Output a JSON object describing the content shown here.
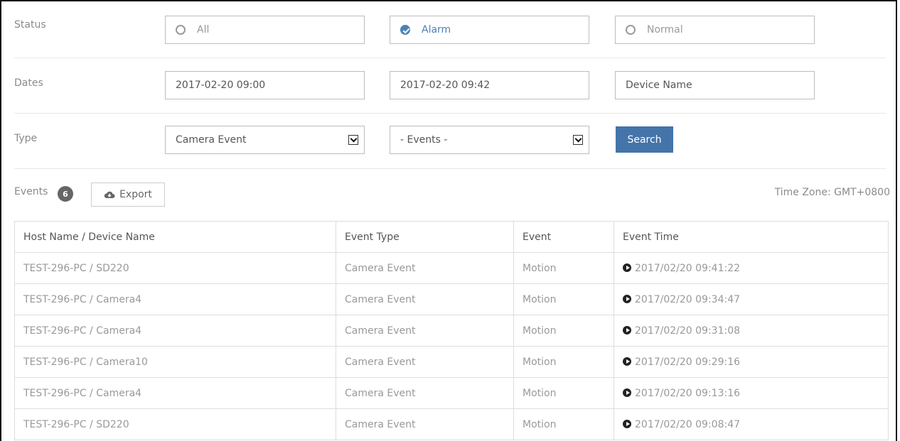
{
  "filters": {
    "status": {
      "label": "Status",
      "options": [
        {
          "label": "All",
          "checked": false
        },
        {
          "label": "Alarm",
          "checked": true
        },
        {
          "label": "Normal",
          "checked": false
        }
      ]
    },
    "dates": {
      "label": "Dates",
      "start": "2017-02-20 09:00",
      "end": "2017-02-20 09:42",
      "device_name": "Device Name"
    },
    "type": {
      "label": "Type",
      "type_select": "Camera Event",
      "event_select": "- Events -",
      "search_label": "Search"
    }
  },
  "events": {
    "label": "Events",
    "count": "6",
    "export_label": "Export",
    "timezone": "Time Zone: GMT+0800"
  },
  "table": {
    "headers": [
      "Host Name / Device Name",
      "Event Type",
      "Event",
      "Event Time"
    ],
    "rows": [
      [
        "TEST-296-PC / SD220",
        "Camera Event",
        "Motion",
        "2017/02/20 09:41:22"
      ],
      [
        "TEST-296-PC / Camera4",
        "Camera Event",
        "Motion",
        "2017/02/20 09:34:47"
      ],
      [
        "TEST-296-PC / Camera4",
        "Camera Event",
        "Motion",
        "2017/02/20 09:31:08"
      ],
      [
        "TEST-296-PC / Camera10",
        "Camera Event",
        "Motion",
        "2017/02/20 09:29:16"
      ],
      [
        "TEST-296-PC / Camera4",
        "Camera Event",
        "Motion",
        "2017/02/20 09:13:16"
      ],
      [
        "TEST-296-PC / SD220",
        "Camera Event",
        "Motion",
        "2017/02/20 09:08:47"
      ]
    ]
  },
  "colors": {
    "accent": "#4474aa",
    "checked": "#4a82b8"
  }
}
